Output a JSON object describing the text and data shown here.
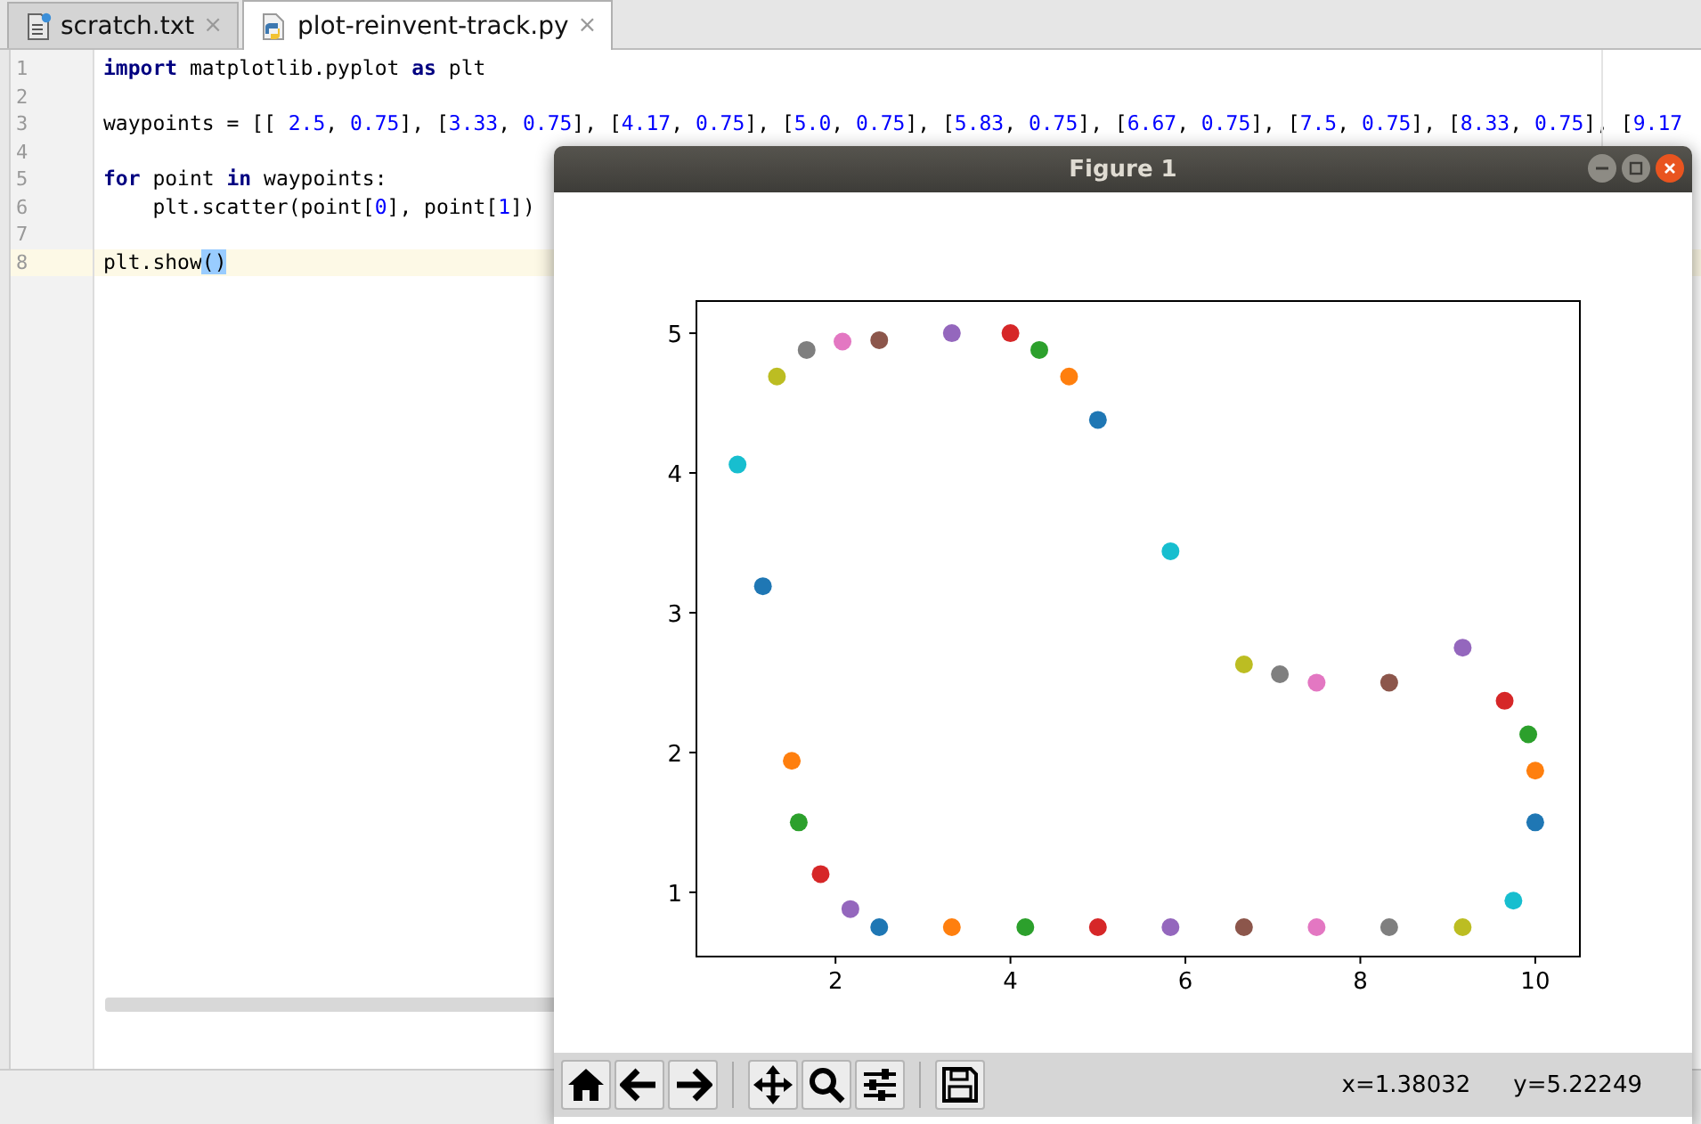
{
  "tabs": [
    {
      "label": "scratch.txt",
      "kind": "text",
      "selected": false,
      "close": "×"
    },
    {
      "label": "plot-reinvent-track.py",
      "kind": "python",
      "selected": true,
      "close": "×"
    }
  ],
  "editor": {
    "lines": [
      {
        "number": "1",
        "current": false,
        "tokens": [
          {
            "kind": "keyword",
            "text": "import"
          },
          {
            "kind": "plain",
            "text": " matplotlib.pyplot "
          },
          {
            "kind": "keyword",
            "text": "as"
          },
          {
            "kind": "plain",
            "text": " plt"
          }
        ]
      },
      {
        "number": "2",
        "current": false
      },
      {
        "number": "3",
        "current": false,
        "tokens": [
          {
            "kind": "plain",
            "text": "waypoints = [[ "
          },
          {
            "kind": "number",
            "text": "2.5"
          },
          {
            "kind": "plain",
            "text": ", "
          },
          {
            "kind": "number",
            "text": "0.75"
          },
          {
            "kind": "plain",
            "text": "], ["
          },
          {
            "kind": "number",
            "text": "3.33"
          },
          {
            "kind": "plain",
            "text": ", "
          },
          {
            "kind": "number",
            "text": "0.75"
          },
          {
            "kind": "plain",
            "text": "], ["
          },
          {
            "kind": "number",
            "text": "4.17"
          },
          {
            "kind": "plain",
            "text": ", "
          },
          {
            "kind": "number",
            "text": "0.75"
          },
          {
            "kind": "plain",
            "text": "], ["
          },
          {
            "kind": "number",
            "text": "5.0"
          },
          {
            "kind": "plain",
            "text": ", "
          },
          {
            "kind": "number",
            "text": "0.75"
          },
          {
            "kind": "plain",
            "text": "], ["
          },
          {
            "kind": "number",
            "text": "5.83"
          },
          {
            "kind": "plain",
            "text": ", "
          },
          {
            "kind": "number",
            "text": "0.75"
          },
          {
            "kind": "plain",
            "text": "], ["
          },
          {
            "kind": "number",
            "text": "6.67"
          },
          {
            "kind": "plain",
            "text": ", "
          },
          {
            "kind": "number",
            "text": "0.75"
          },
          {
            "kind": "plain",
            "text": "], ["
          },
          {
            "kind": "number",
            "text": "7.5"
          },
          {
            "kind": "plain",
            "text": ", "
          },
          {
            "kind": "number",
            "text": "0.75"
          },
          {
            "kind": "plain",
            "text": "], ["
          },
          {
            "kind": "number",
            "text": "8.33"
          },
          {
            "kind": "plain",
            "text": ", "
          },
          {
            "kind": "number",
            "text": "0.75"
          },
          {
            "kind": "plain",
            "text": "], ["
          },
          {
            "kind": "number",
            "text": "9.17"
          }
        ]
      },
      {
        "number": "4",
        "current": false
      },
      {
        "number": "5",
        "current": false,
        "tokens": [
          {
            "kind": "keyword",
            "text": "for"
          },
          {
            "kind": "plain",
            "text": " point "
          },
          {
            "kind": "keyword",
            "text": "in"
          },
          {
            "kind": "plain",
            "text": " waypoints:"
          }
        ]
      },
      {
        "number": "6",
        "current": false,
        "tokens": [
          {
            "kind": "plain",
            "text": "    plt.scatter(point["
          },
          {
            "kind": "number",
            "text": "0"
          },
          {
            "kind": "plain",
            "text": "], point["
          },
          {
            "kind": "number",
            "text": "1"
          },
          {
            "kind": "plain",
            "text": "])"
          }
        ]
      },
      {
        "number": "7",
        "current": false
      },
      {
        "number": "8",
        "current": true,
        "tokens": [
          {
            "kind": "plain",
            "text": "plt.show"
          },
          {
            "kind": "match",
            "text": "()"
          }
        ]
      }
    ]
  },
  "figure": {
    "title": "Figure 1",
    "toolbar": [
      {
        "kind": "home"
      },
      {
        "kind": "back"
      },
      {
        "kind": "forward"
      },
      {
        "kind": "separator"
      },
      {
        "kind": "pan"
      },
      {
        "kind": "zoom"
      },
      {
        "kind": "configure"
      },
      {
        "kind": "separator"
      },
      {
        "kind": "save"
      }
    ],
    "coords": [
      "x=1.38032",
      "y=5.22249"
    ],
    "chart_data": {
      "type": "scatter",
      "xlim": [
        0.41,
        10.51
      ],
      "ylim": [
        0.54,
        5.23
      ],
      "xticks": [
        2,
        4,
        6,
        8,
        10
      ],
      "yticks": [
        1,
        2,
        3,
        4,
        5
      ],
      "series": [
        {
          "color": "#1f77b4",
          "x": [
            2.5
          ],
          "values": [
            0.75
          ]
        },
        {
          "color": "#ff7f0e",
          "x": [
            3.33
          ],
          "values": [
            0.75
          ]
        },
        {
          "color": "#2ca02c",
          "x": [
            4.17
          ],
          "values": [
            0.75
          ]
        },
        {
          "color": "#d62728",
          "x": [
            5.0
          ],
          "values": [
            0.75
          ]
        },
        {
          "color": "#9467bd",
          "x": [
            5.83
          ],
          "values": [
            0.75
          ]
        },
        {
          "color": "#8c564b",
          "x": [
            6.67
          ],
          "values": [
            0.75
          ]
        },
        {
          "color": "#e377c2",
          "x": [
            7.5
          ],
          "values": [
            0.75
          ]
        },
        {
          "color": "#7f7f7f",
          "x": [
            8.33
          ],
          "values": [
            0.75
          ]
        },
        {
          "color": "#bcbd22",
          "x": [
            9.17
          ],
          "values": [
            0.75
          ]
        },
        {
          "color": "#17becf",
          "x": [
            9.75
          ],
          "values": [
            0.94
          ]
        },
        {
          "color": "#1f77b4",
          "x": [
            10.0
          ],
          "values": [
            1.5
          ]
        },
        {
          "color": "#ff7f0e",
          "x": [
            10.0
          ],
          "values": [
            1.87
          ]
        },
        {
          "color": "#2ca02c",
          "x": [
            9.92
          ],
          "values": [
            2.13
          ]
        },
        {
          "color": "#d62728",
          "x": [
            9.65
          ],
          "values": [
            2.37
          ]
        },
        {
          "color": "#9467bd",
          "x": [
            9.17
          ],
          "values": [
            2.75
          ]
        },
        {
          "color": "#8c564b",
          "x": [
            8.33
          ],
          "values": [
            2.5
          ]
        },
        {
          "color": "#e377c2",
          "x": [
            7.5
          ],
          "values": [
            2.5
          ]
        },
        {
          "color": "#7f7f7f",
          "x": [
            7.08
          ],
          "values": [
            2.56
          ]
        },
        {
          "color": "#bcbd22",
          "x": [
            6.67
          ],
          "values": [
            2.63
          ]
        },
        {
          "color": "#17becf",
          "x": [
            5.83
          ],
          "values": [
            3.44
          ]
        },
        {
          "color": "#1f77b4",
          "x": [
            5.0
          ],
          "values": [
            4.38
          ]
        },
        {
          "color": "#ff7f0e",
          "x": [
            4.67
          ],
          "values": [
            4.69
          ]
        },
        {
          "color": "#2ca02c",
          "x": [
            4.33
          ],
          "values": [
            4.88
          ]
        },
        {
          "color": "#d62728",
          "x": [
            4.0
          ],
          "values": [
            5.0
          ]
        },
        {
          "color": "#9467bd",
          "x": [
            3.33
          ],
          "values": [
            5.0
          ]
        },
        {
          "color": "#8c564b",
          "x": [
            2.5
          ],
          "values": [
            4.95
          ]
        },
        {
          "color": "#e377c2",
          "x": [
            2.08
          ],
          "values": [
            4.94
          ]
        },
        {
          "color": "#7f7f7f",
          "x": [
            1.67
          ],
          "values": [
            4.88
          ]
        },
        {
          "color": "#bcbd22",
          "x": [
            1.33
          ],
          "values": [
            4.69
          ]
        },
        {
          "color": "#17becf",
          "x": [
            0.88
          ],
          "values": [
            4.06
          ]
        },
        {
          "color": "#1f77b4",
          "x": [
            1.17
          ],
          "values": [
            3.19
          ]
        },
        {
          "color": "#ff7f0e",
          "x": [
            1.5
          ],
          "values": [
            1.94
          ]
        },
        {
          "color": "#2ca02c",
          "x": [
            1.58
          ],
          "values": [
            1.5
          ]
        },
        {
          "color": "#d62728",
          "x": [
            1.83
          ],
          "values": [
            1.13
          ]
        },
        {
          "color": "#9467bd",
          "x": [
            2.17
          ],
          "values": [
            0.88
          ]
        }
      ]
    }
  }
}
